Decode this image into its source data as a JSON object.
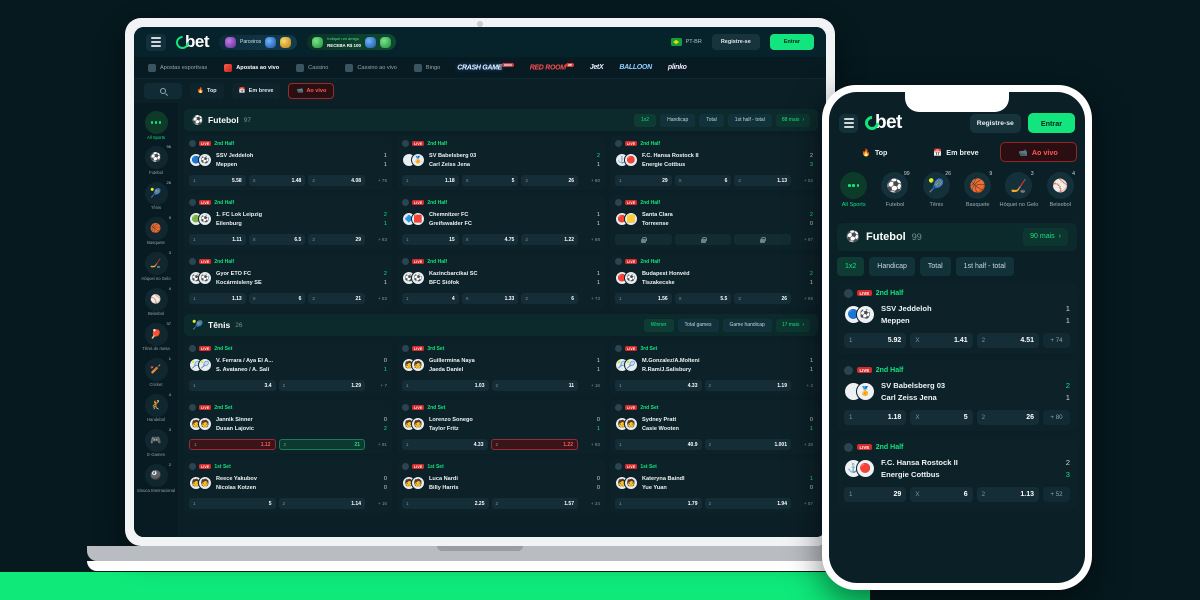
{
  "brand": {
    "name": "bet",
    "accent": "#12e57e"
  },
  "desktop": {
    "topbar": {
      "partners_label": "Parceiros",
      "referral_line1": "Indique um amigo",
      "referral_line2": "RECEBA R$ 100",
      "language": "PT-BR",
      "register_label": "Registre-se",
      "login_label": "Entrar"
    },
    "nav": [
      {
        "label": "Apostas esportivas",
        "active": false
      },
      {
        "label": "Apostas ao vivo",
        "active": true
      },
      {
        "label": "Cassino",
        "active": false
      },
      {
        "label": "Cassino ao vivo",
        "active": false
      },
      {
        "label": "Bingo",
        "active": false
      }
    ],
    "game_logos": [
      {
        "label": "CRASH GAME",
        "badge": "NOVO"
      },
      {
        "label": "RED ROOM",
        "badge": "VIP"
      },
      {
        "label": "JetX",
        "badge": ""
      },
      {
        "label": "BALLOON",
        "badge": ""
      },
      {
        "label": "plinko",
        "badge": ""
      }
    ],
    "subbar": {
      "tabs": [
        {
          "label": "Top",
          "icon": "fire-icon",
          "active": false
        },
        {
          "label": "Em breve",
          "icon": "calendar-icon",
          "active": false
        },
        {
          "label": "Ao vivo",
          "icon": "live-icon",
          "active": true
        }
      ]
    },
    "sidebar": [
      {
        "label": "All Sports",
        "count": "",
        "icon": "dots-icon",
        "selected": true
      },
      {
        "label": "Futebol",
        "count": "96",
        "icon": "soccer-icon",
        "selected": false
      },
      {
        "label": "Tênis",
        "count": "26",
        "icon": "tennis-icon",
        "selected": false
      },
      {
        "label": "Basquete",
        "count": "9",
        "icon": "basketball-icon",
        "selected": false
      },
      {
        "label": "Hóquei no Gelo",
        "count": "3",
        "icon": "hockey-icon",
        "selected": false
      },
      {
        "label": "Beisebol",
        "count": "4",
        "icon": "baseball-icon",
        "selected": false
      },
      {
        "label": "Tênis de mesa",
        "count": "37",
        "icon": "pingpong-icon",
        "selected": false
      },
      {
        "label": "Cricket",
        "count": "1",
        "icon": "cricket-icon",
        "selected": false
      },
      {
        "label": "Handebol",
        "count": "4",
        "icon": "handball-icon",
        "selected": false
      },
      {
        "label": "E-Games",
        "count": "3",
        "icon": "gamepad-icon",
        "selected": false
      },
      {
        "label": "Sinuca Internacional",
        "count": "2",
        "icon": "snooker-icon",
        "selected": false
      }
    ],
    "sections": [
      {
        "title": "Futebol",
        "count": "97",
        "icon": "soccer-icon",
        "filters": [
          {
            "label": "1x2",
            "active": true
          },
          {
            "label": "Handicap",
            "active": false
          },
          {
            "label": "Total",
            "active": false
          },
          {
            "label": "1st half - total",
            "active": false
          }
        ],
        "more_label": "88 mais",
        "matches": [
          {
            "phase": "2nd Half",
            "live": "LIVE",
            "home": "SSV Jeddeloh",
            "away": "Meppen",
            "home_score": "1",
            "away_score": "1",
            "winner": "",
            "odds": [
              {
                "key": "1",
                "value": "5.58",
                "state": "normal"
              },
              {
                "key": "X",
                "value": "1.48",
                "state": "normal"
              },
              {
                "key": "2",
                "value": "4.08",
                "state": "normal"
              }
            ],
            "more": "+ 75"
          },
          {
            "phase": "2nd Half",
            "live": "LIVE",
            "home": "SV Babelsberg 03",
            "away": "Carl Zeiss Jena",
            "home_score": "2",
            "away_score": "1",
            "winner": "home",
            "odds": [
              {
                "key": "1",
                "value": "1.18",
                "state": "normal"
              },
              {
                "key": "X",
                "value": "5",
                "state": "normal"
              },
              {
                "key": "2",
                "value": "26",
                "state": "normal"
              }
            ],
            "more": "+ 80"
          },
          {
            "phase": "2nd Half",
            "live": "LIVE",
            "home": "F.C. Hansa Rostock II",
            "away": "Energie Cottbus",
            "home_score": "2",
            "away_score": "3",
            "winner": "away",
            "odds": [
              {
                "key": "1",
                "value": "29",
                "state": "normal"
              },
              {
                "key": "X",
                "value": "6",
                "state": "normal"
              },
              {
                "key": "2",
                "value": "1.13",
                "state": "normal"
              }
            ],
            "more": "+ 52"
          },
          {
            "phase": "2nd Half",
            "live": "LIVE",
            "home": "1. FC Lok Leipzig",
            "away": "Eilenburg",
            "home_score": "2",
            "away_score": "1",
            "winner": "both",
            "odds": [
              {
                "key": "1",
                "value": "1.11",
                "state": "normal"
              },
              {
                "key": "X",
                "value": "6.5",
                "state": "normal"
              },
              {
                "key": "2",
                "value": "29",
                "state": "normal"
              }
            ],
            "more": "+ 83"
          },
          {
            "phase": "2nd Half",
            "live": "LIVE",
            "home": "Chemnitzer FC",
            "away": "Greifswalder FC",
            "home_score": "1",
            "away_score": "1",
            "winner": "",
            "odds": [
              {
                "key": "1",
                "value": "15",
                "state": "normal"
              },
              {
                "key": "X",
                "value": "4.75",
                "state": "normal"
              },
              {
                "key": "2",
                "value": "1.22",
                "state": "normal"
              }
            ],
            "more": "+ 88"
          },
          {
            "phase": "2nd Half",
            "live": "LIVE",
            "home": "Santa Clara",
            "away": "Torreense",
            "home_score": "2",
            "away_score": "0",
            "winner": "home",
            "odds": [
              {
                "key": "",
                "value": "",
                "state": "locked"
              },
              {
                "key": "",
                "value": "",
                "state": "locked"
              },
              {
                "key": "",
                "value": "",
                "state": "locked"
              }
            ],
            "more": "+ 97"
          },
          {
            "phase": "2nd Half",
            "live": "LIVE",
            "home": "Gyor ETO FC",
            "away": "Kocármisleny SE",
            "home_score": "2",
            "away_score": "1",
            "winner": "home",
            "odds": [
              {
                "key": "1",
                "value": "1.13",
                "state": "normal"
              },
              {
                "key": "X",
                "value": "6",
                "state": "normal"
              },
              {
                "key": "2",
                "value": "21",
                "state": "normal"
              }
            ],
            "more": "+ 53"
          },
          {
            "phase": "2nd Half",
            "live": "LIVE",
            "home": "Kazincbarcikai SC",
            "away": "BFC Siófok",
            "home_score": "1",
            "away_score": "1",
            "winner": "",
            "odds": [
              {
                "key": "1",
                "value": "4",
                "state": "normal"
              },
              {
                "key": "X",
                "value": "1.33",
                "state": "normal"
              },
              {
                "key": "2",
                "value": "6",
                "state": "normal"
              }
            ],
            "more": "+ 73"
          },
          {
            "phase": "2nd Half",
            "live": "LIVE",
            "home": "Budapest Honvéd",
            "away": "Tiszakecske",
            "home_score": "2",
            "away_score": "1",
            "winner": "home",
            "odds": [
              {
                "key": "1",
                "value": "1.56",
                "state": "normal"
              },
              {
                "key": "X",
                "value": "5.5",
                "state": "normal"
              },
              {
                "key": "2",
                "value": "26",
                "state": "normal"
              }
            ],
            "more": "+ 69"
          }
        ]
      },
      {
        "title": "Tênis",
        "count": "26",
        "icon": "tennis-icon",
        "filters": [
          {
            "label": "Winner",
            "active": true
          },
          {
            "label": "Total games",
            "active": false
          },
          {
            "label": "Game handicap",
            "active": false
          }
        ],
        "more_label": "17 mais",
        "matches": [
          {
            "phase": "2nd Set",
            "live": "LIVE",
            "home": "V. Ferrara / Aya El A...",
            "away": "S. Avataneo / A. Salí",
            "home_score": "0",
            "away_score": "1",
            "winner": "away",
            "odds": [
              {
                "key": "1",
                "value": "3.4",
                "state": "normal"
              },
              {
                "key": "2",
                "value": "1.29",
                "state": "normal"
              }
            ],
            "more": "+ 7"
          },
          {
            "phase": "3rd Set",
            "live": "LIVE",
            "home": "Guillermina Naya",
            "away": "Jaeda Daniel",
            "home_score": "1",
            "away_score": "1",
            "winner": "",
            "odds": [
              {
                "key": "1",
                "value": "1.03",
                "state": "normal"
              },
              {
                "key": "2",
                "value": "11",
                "state": "normal"
              }
            ],
            "more": "+ 16"
          },
          {
            "phase": "3rd Set",
            "live": "LIVE",
            "home": "M.Gonzalez/A.Molteni",
            "away": "R.Ram/J.Salisbury",
            "home_score": "1",
            "away_score": "1",
            "winner": "",
            "odds": [
              {
                "key": "1",
                "value": "4.33",
                "state": "normal"
              },
              {
                "key": "2",
                "value": "1.19",
                "state": "normal"
              }
            ],
            "more": "+ 2"
          },
          {
            "phase": "2nd Set",
            "live": "LIVE",
            "home": "Jannik Sinner",
            "away": "Dusan Lajovic",
            "home_score": "0",
            "away_score": "2",
            "winner": "away",
            "odds": [
              {
                "key": "1",
                "value": "1.12",
                "state": "down"
              },
              {
                "key": "2",
                "value": "21",
                "state": "up"
              }
            ],
            "more": "+ 91"
          },
          {
            "phase": "2nd Set",
            "live": "LIVE",
            "home": "Lorenzo Sonego",
            "away": "Taylor Fritz",
            "home_score": "0",
            "away_score": "1",
            "winner": "away",
            "odds": [
              {
                "key": "1",
                "value": "4.33",
                "state": "normal"
              },
              {
                "key": "2",
                "value": "1.22",
                "state": "down"
              }
            ],
            "more": "+ 93"
          },
          {
            "phase": "2nd Set",
            "live": "LIVE",
            "home": "Sydney Pratt",
            "away": "Casie Wooten",
            "home_score": "0",
            "away_score": "1",
            "winner": "away",
            "odds": [
              {
                "key": "1",
                "value": "40.9",
                "state": "normal"
              },
              {
                "key": "2",
                "value": "1.001",
                "state": "normal"
              }
            ],
            "more": "+ 28"
          },
          {
            "phase": "1st Set",
            "live": "LIVE",
            "home": "Reece Yakubov",
            "away": "Nicolas Kotzen",
            "home_score": "0",
            "away_score": "0",
            "winner": "",
            "odds": [
              {
                "key": "1",
                "value": "5",
                "state": "normal"
              },
              {
                "key": "2",
                "value": "1.14",
                "state": "normal"
              }
            ],
            "more": "+ 16"
          },
          {
            "phase": "1st Set",
            "live": "LIVE",
            "home": "Luca Nardi",
            "away": "Billy Harris",
            "home_score": "0",
            "away_score": "0",
            "winner": "",
            "odds": [
              {
                "key": "1",
                "value": "2.25",
                "state": "normal"
              },
              {
                "key": "2",
                "value": "1.57",
                "state": "normal"
              }
            ],
            "more": "+ 24"
          },
          {
            "phase": "1st Set",
            "live": "LIVE",
            "home": "Kateryna Baindl",
            "away": "Yue Yuan",
            "home_score": "1",
            "away_score": "0",
            "winner": "home",
            "odds": [
              {
                "key": "1",
                "value": "1.79",
                "state": "normal"
              },
              {
                "key": "2",
                "value": "1.94",
                "state": "normal"
              }
            ],
            "more": "+ 57"
          }
        ]
      }
    ]
  },
  "mobile": {
    "header": {
      "register_label": "Registre-se",
      "login_label": "Entrar"
    },
    "tabs": [
      {
        "label": "Top",
        "icon": "fire-icon",
        "active": false
      },
      {
        "label": "Em breve",
        "icon": "calendar-icon",
        "active": false
      },
      {
        "label": "Ao vivo",
        "icon": "live-icon",
        "active": true
      }
    ],
    "sports": [
      {
        "label": "All Sports",
        "count": "",
        "icon": "dots-icon",
        "selected": true
      },
      {
        "label": "Futebol",
        "count": "99",
        "icon": "soccer-icon",
        "selected": false
      },
      {
        "label": "Tênis",
        "count": "26",
        "icon": "tennis-icon",
        "selected": false
      },
      {
        "label": "Basquete",
        "count": "9",
        "icon": "basketball-icon",
        "selected": false
      },
      {
        "label": "Hóquei no Gelo",
        "count": "3",
        "icon": "hockey-icon",
        "selected": false
      },
      {
        "label": "Beisebol",
        "count": "4",
        "icon": "baseball-icon",
        "selected": false
      }
    ],
    "section": {
      "title": "Futebol",
      "count": "99",
      "icon": "soccer-icon",
      "more_label": "90 mais",
      "filters": [
        {
          "label": "1x2",
          "active": true
        },
        {
          "label": "Handicap",
          "active": false
        },
        {
          "label": "Total",
          "active": false
        },
        {
          "label": "1st half - total",
          "active": false
        }
      ]
    },
    "matches": [
      {
        "phase": "2nd Half",
        "live": "LIVE",
        "home": "SSV Jeddeloh",
        "away": "Meppen",
        "home_score": "1",
        "away_score": "1",
        "winner": "",
        "odds": [
          {
            "key": "1",
            "value": "5.92"
          },
          {
            "key": "X",
            "value": "1.41"
          },
          {
            "key": "2",
            "value": "4.51"
          }
        ],
        "more": "+ 74"
      },
      {
        "phase": "2nd Half",
        "live": "LIVE",
        "home": "SV Babelsberg 03",
        "away": "Carl Zeiss Jena",
        "home_score": "2",
        "away_score": "1",
        "winner": "home",
        "odds": [
          {
            "key": "1",
            "value": "1.18"
          },
          {
            "key": "X",
            "value": "5"
          },
          {
            "key": "2",
            "value": "26"
          }
        ],
        "more": "+ 80"
      },
      {
        "phase": "2nd Half",
        "live": "LIVE",
        "home": "F.C. Hansa Rostock II",
        "away": "Energie Cottbus",
        "home_score": "2",
        "away_score": "3",
        "winner": "away",
        "odds": [
          {
            "key": "1",
            "value": "29"
          },
          {
            "key": "X",
            "value": "6"
          },
          {
            "key": "2",
            "value": "1.13"
          }
        ],
        "more": "+ 52"
      }
    ]
  }
}
